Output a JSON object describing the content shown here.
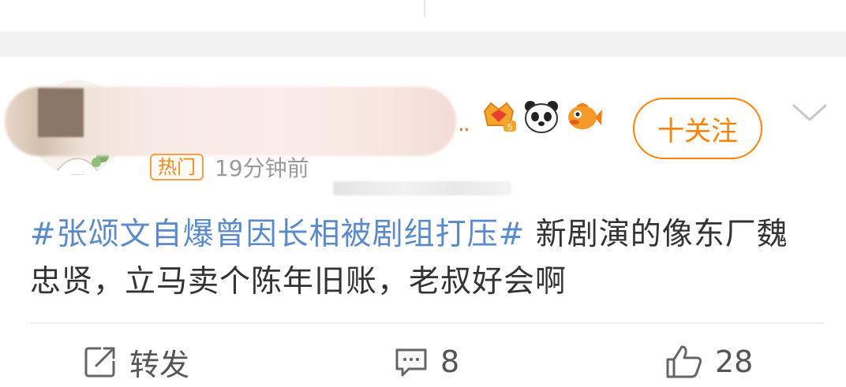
{
  "post": {
    "tag": "热门",
    "time": "19分钟前",
    "hashtag": "#张颂文自爆曾因长相被剧组打压#",
    "body": " 新剧演的像东厂魏忠贤，立马卖个陈年旧账，老叔好会啊",
    "follow_label": "十关注",
    "badges": [
      "vip-crown-icon",
      "panda-emoji-icon",
      "fish-emoji-icon"
    ]
  },
  "actions": {
    "repost_label": "转发",
    "comment_count": "8",
    "like_count": "28"
  },
  "colors": {
    "accent": "#ff8200",
    "hashtag": "#5b8ac9",
    "text": "#333333",
    "muted": "#9a9a9a"
  }
}
